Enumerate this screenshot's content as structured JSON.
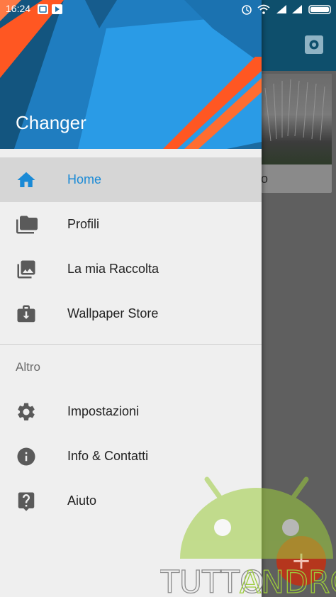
{
  "status_bar": {
    "time": "16:24"
  },
  "background_app": {
    "card_caption": "o",
    "fab_label": "+"
  },
  "drawer": {
    "app_name": "Changer",
    "items": [
      {
        "label": "Home",
        "icon": "home-icon",
        "active": true
      },
      {
        "label": "Profili",
        "icon": "folder-icon",
        "active": false
      },
      {
        "label": "La mia Raccolta",
        "icon": "photo-library-icon",
        "active": false
      },
      {
        "label": "Wallpaper Store",
        "icon": "store-download-icon",
        "active": false
      }
    ],
    "section_title": "Altro",
    "secondary_items": [
      {
        "label": "Impostazioni",
        "icon": "gear-icon"
      },
      {
        "label": "Info & Contatti",
        "icon": "info-icon"
      },
      {
        "label": "Aiuto",
        "icon": "help-icon"
      }
    ]
  },
  "watermark": {
    "text_left": "TUTTO",
    "text_right": "ANDROID"
  },
  "colors": {
    "accent": "#1a8ad6",
    "header_blue": "#1d6fa6",
    "header_orange": "#ff5722",
    "fab": "#b5361d"
  }
}
